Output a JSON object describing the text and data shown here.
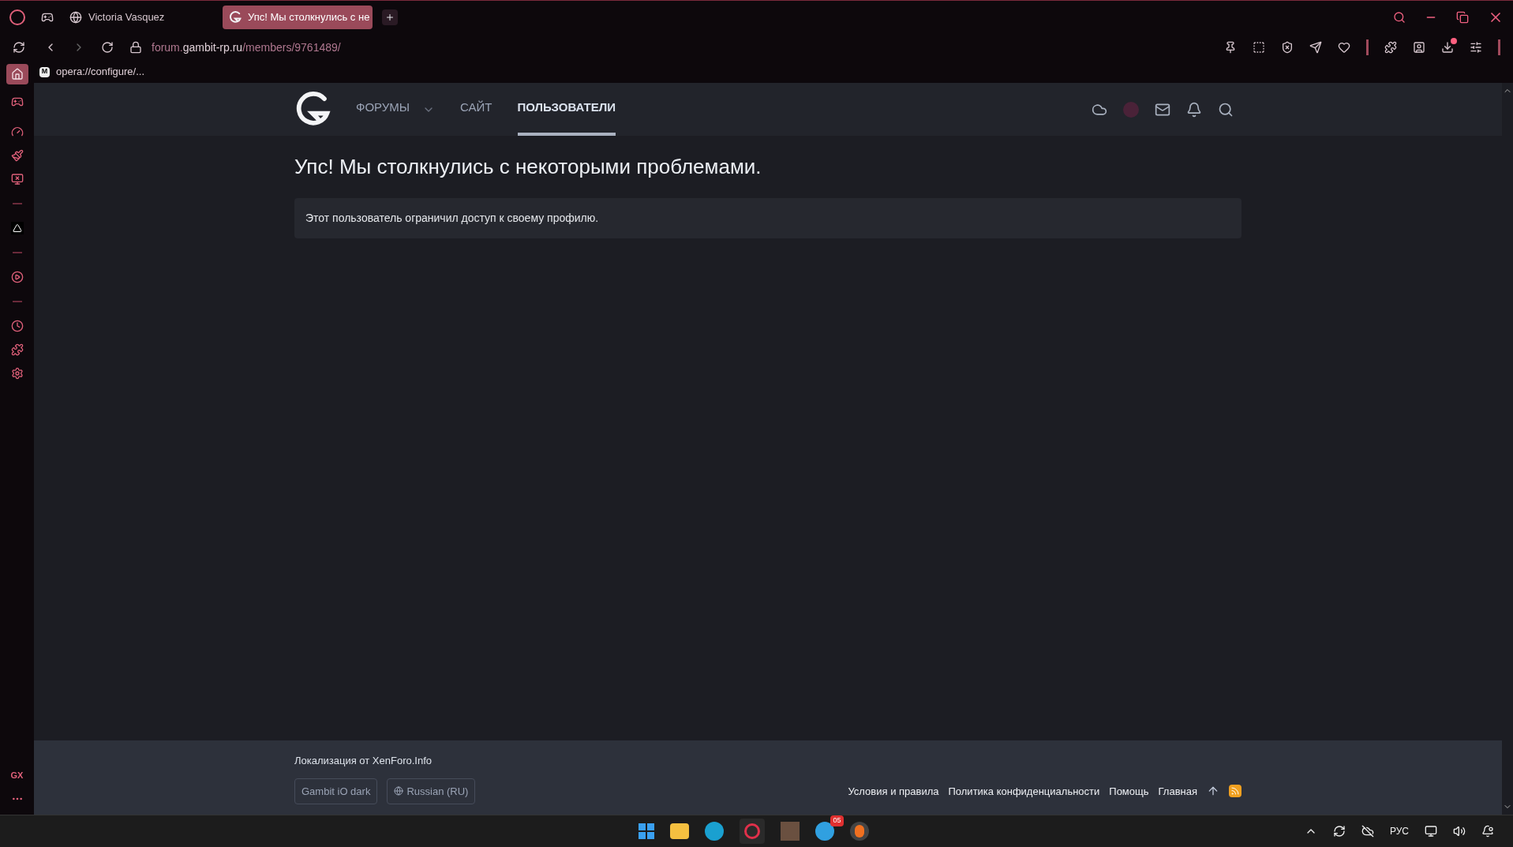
{
  "browser": {
    "tabs": [
      {
        "label": "Victoria Vasquez",
        "selected": false
      },
      {
        "label": "Упс! Мы столкнулись с не",
        "selected": true
      }
    ],
    "url": {
      "subdomain": "forum.",
      "domain": "gambit-rp.ru",
      "path": "/members/9761489/"
    },
    "bookmark": {
      "badge": "M",
      "label": "opera://configure/..."
    },
    "sidebar_footer": "GX"
  },
  "site": {
    "nav": [
      {
        "label": "ФОРУМЫ",
        "selected": false,
        "dropdown": true
      },
      {
        "label": "САЙТ",
        "selected": false,
        "dropdown": false
      },
      {
        "label": "ПОЛЬЗОВАТЕЛИ",
        "selected": true,
        "dropdown": false
      }
    ],
    "title": "Упс! Мы столкнулись с некоторыми проблемами.",
    "message": "Этот пользователь ограничил доступ к своему профилю.",
    "footer": {
      "credit": "Локализация от XenForo.Info",
      "style_button": "Gambit iO dark",
      "language_button": "Russian (RU)",
      "links": [
        "Условия и правила",
        "Политика конфиденциальности",
        "Помощь",
        "Главная"
      ]
    }
  },
  "taskbar": {
    "telegram_badge": "05",
    "language": "РУС"
  }
}
